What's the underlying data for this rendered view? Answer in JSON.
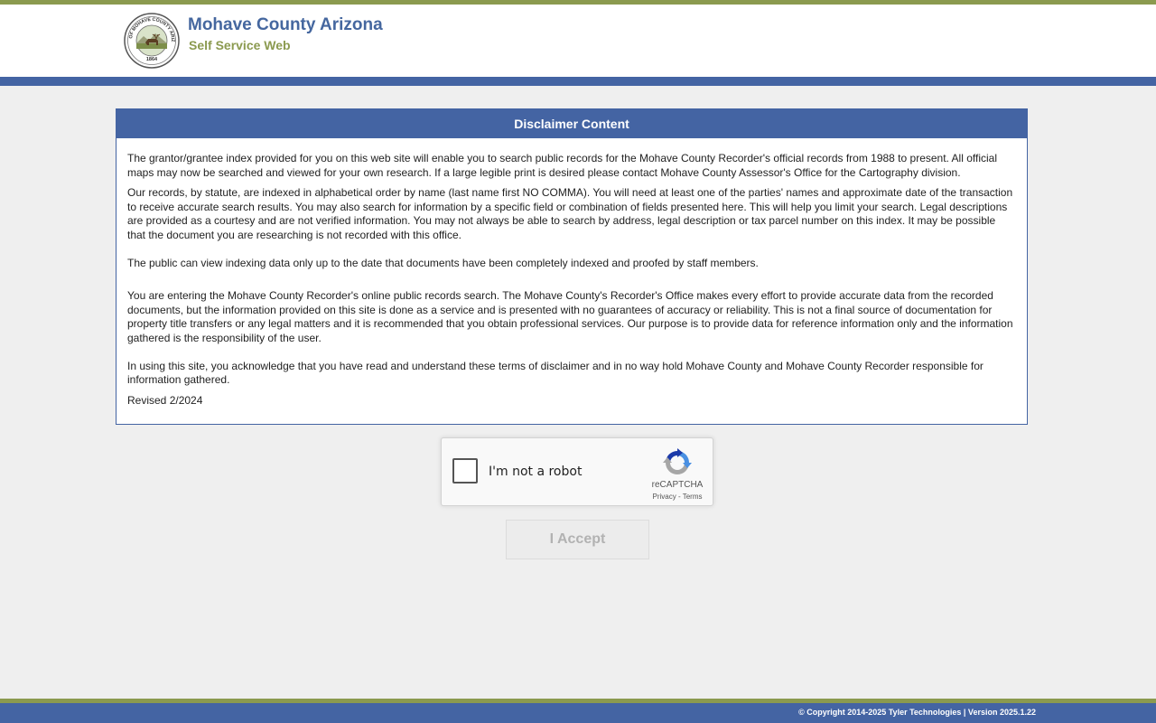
{
  "header": {
    "title": "Mohave County Arizona",
    "subtitle": "Self Service Web",
    "seal": {
      "icon": "county-seal-icon",
      "text_top": "SEAL OF MOHAVE COUNTY ARIZONA",
      "text_bottom": "1864"
    }
  },
  "disclaimer": {
    "heading": "Disclaimer Content",
    "paragraphs": [
      "The grantor/grantee index provided for you on this web site will enable you to search public records for the Mohave County Recorder's official records from 1988 to present. All official maps may now be searched and viewed for your own research. If a large legible print is desired please contact Mohave County Assessor's Office for the Cartography division.",
      "Our records, by statute, are indexed in alphabetical order by name (last name first NO COMMA). You will need at least one of the parties' names and approximate date of the transaction to receive accurate search results. You may also search for information by a specific field or combination of fields presented here. This will help you limit your search. Legal descriptions are provided as a courtesy and are not verified information. You may not always be able to search by address, legal description or tax parcel number on this index. It may be possible that the document you are researching is not recorded with this office.",
      "The public can view indexing data only up to the date that documents have been completely indexed and proofed by staff members.",
      "You are entering the Mohave County Recorder's online public records search. The Mohave County's Recorder's Office makes every effort to provide accurate data from the recorded documents, but the information provided on this site is done as a service and is presented with no guarantees of accuracy or reliability. This is not a final source of documentation for property title transfers or any legal matters and it is recommended that you obtain professional services. Our purpose is to provide data for reference information only and the information gathered is the responsibility of the user.",
      "In using this site, you acknowledge that you have read and understand these terms of disclaimer and in no way hold Mohave County and Mohave County Recorder responsible for information gathered.",
      "Revised 2/2024"
    ]
  },
  "captcha": {
    "label": "I'm not a robot",
    "brand": "reCAPTCHA",
    "privacy": "Privacy",
    "separator": " - ",
    "terms": "Terms",
    "checked": false
  },
  "accept_button": {
    "label": "I Accept",
    "disabled": true
  },
  "footer": {
    "text": "© Copyright 2014-2025 Tyler Technologies | Version 2025.1.22"
  },
  "colors": {
    "brand_blue": "#4464a3",
    "brand_olive": "#8b9a4f",
    "page_background": "#efefef"
  }
}
